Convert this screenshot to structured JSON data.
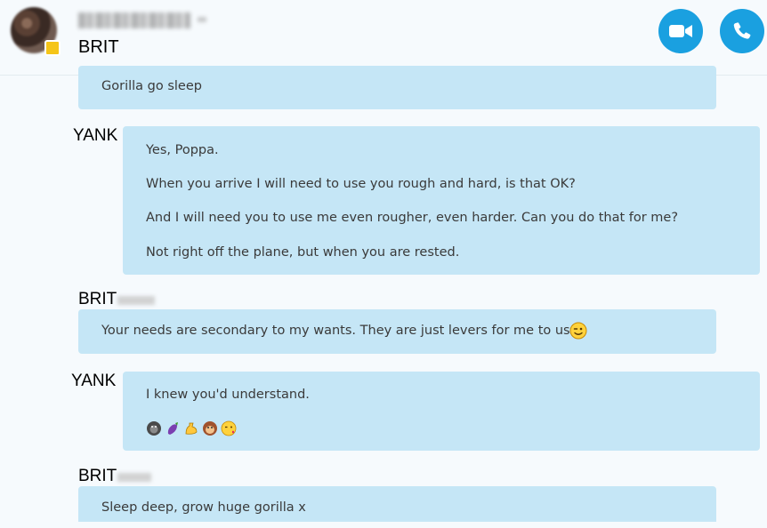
{
  "header": {
    "contact_subtitle": "BRIT",
    "presence_color": "#f5c518",
    "video_call_icon": "video-camera-icon",
    "audio_call_icon": "phone-icon",
    "accent_color": "#1aa0e0"
  },
  "messages": [
    {
      "sender": "",
      "lines": [
        "Gorilla go sleep"
      ]
    },
    {
      "sender": "YANK",
      "lines": [
        "Yes, Poppa.",
        "When you arrive I will need to use you rough and hard, is that OK?",
        "And I will need you to use me even rougher, even harder. Can you do that for me?",
        "Not right off the plane, but when you are rested."
      ]
    },
    {
      "sender": "BRIT",
      "lines": [
        "Your needs are secondary to my wants. They are just levers for me to use"
      ],
      "emoji": "winking-face"
    },
    {
      "sender": "YANK",
      "lines": [
        "I knew you'd understand."
      ],
      "emojis": [
        "gorilla",
        "eggplant",
        "flexed-biceps",
        "monkey-face",
        "face-blowing-kiss"
      ]
    },
    {
      "sender": "BRIT",
      "lines": [
        "Sleep deep, grow huge gorilla x"
      ]
    }
  ],
  "colors": {
    "bubble_background": "#c5e6f6",
    "page_background": "#f6fafd"
  }
}
